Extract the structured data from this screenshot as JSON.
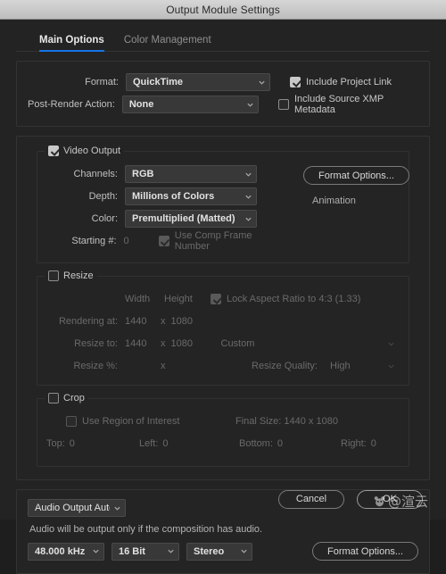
{
  "window": {
    "title": "Output Module Settings"
  },
  "tabs": [
    {
      "label": "Main Options",
      "active": true
    },
    {
      "label": "Color Management",
      "active": false
    }
  ],
  "format_section": {
    "format_label": "Format:",
    "format_value": "QuickTime",
    "post_render_label": "Post-Render Action:",
    "post_render_value": "None",
    "include_project_link_label": "Include Project Link",
    "include_project_link_checked": true,
    "include_xmp_label": "Include Source XMP Metadata",
    "include_xmp_checked": false
  },
  "video_output": {
    "legend": "Video Output",
    "enabled": true,
    "channels_label": "Channels:",
    "channels_value": "RGB",
    "depth_label": "Depth:",
    "depth_value": "Millions of Colors",
    "color_label": "Color:",
    "color_value": "Premultiplied (Matted)",
    "starting_label": "Starting #:",
    "starting_value": "0",
    "use_comp_frame_label": "Use Comp Frame Number",
    "use_comp_frame_checked": true,
    "format_options_label": "Format Options...",
    "codec_name": "Animation"
  },
  "resize": {
    "legend": "Resize",
    "checked": false,
    "width_header": "Width",
    "height_header": "Height",
    "lock_aspect_label": "Lock Aspect Ratio to 4:3 (1.33)",
    "lock_aspect_checked": true,
    "rendering_at_label": "Rendering at:",
    "rendering_width": "1440",
    "rendering_height": "1080",
    "resize_to_label": "Resize to:",
    "resize_width": "1440",
    "resize_height": "1080",
    "preset_value": "Custom",
    "resize_pct_label": "Resize %:",
    "resize_pct_value": "",
    "quality_label": "Resize Quality:",
    "quality_value": "High",
    "x_symbol": "x"
  },
  "crop": {
    "legend": "Crop",
    "checked": false,
    "region_of_interest_label": "Use Region of Interest",
    "region_of_interest_checked": false,
    "final_size_label": "Final Size: 1440 x 1080",
    "top_label": "Top:",
    "top_value": "0",
    "left_label": "Left:",
    "left_value": "0",
    "bottom_label": "Bottom:",
    "bottom_value": "0",
    "right_label": "Right:",
    "right_value": "0"
  },
  "audio": {
    "mode_value": "Audio Output Auto",
    "note": "Audio will be output only if the composition has audio.",
    "sample_rate": "48.000 kHz",
    "bit_depth": "16 Bit",
    "channels": "Stereo",
    "format_options_label": "Format Options..."
  },
  "footer": {
    "cancel_label": "Cancel",
    "ok_label": "OK"
  },
  "watermark": {
    "handle": "@渲云"
  },
  "colors": {
    "accent": "#1473e6",
    "panel_bg": "#242424",
    "dialog_bg": "#232323",
    "titlebar": "#cccccc"
  }
}
